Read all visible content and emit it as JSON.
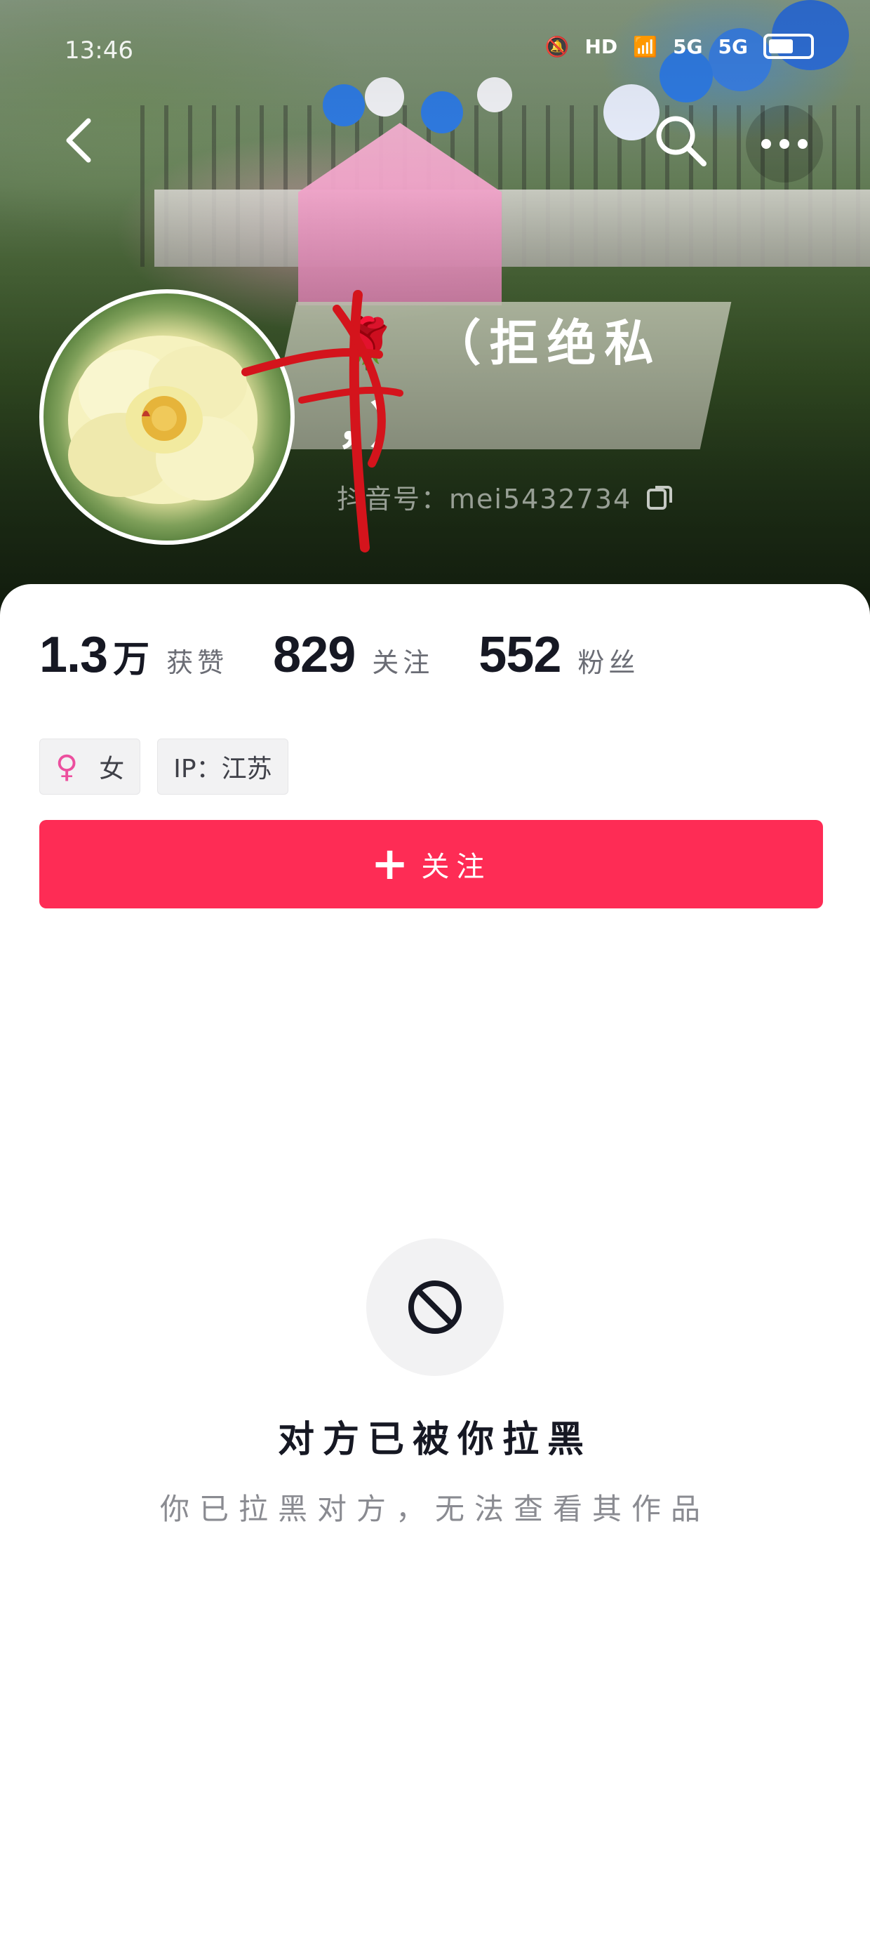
{
  "status_bar": {
    "time": "13:46",
    "hd_label": "HD",
    "signal1_label": "5G",
    "signal2_label": "5G",
    "battery_level": 0.6
  },
  "profile": {
    "nickname_line1": "🌹 （拒绝私",
    "nickname_line2": "，）",
    "douyin_id": "抖音号：mei5432734"
  },
  "stats": {
    "likes_num": "1.3",
    "likes_unit": "万",
    "likes_label": "获赞",
    "following_num": "829",
    "following_label": "关注",
    "followers_num": "552",
    "followers_label": "粉丝"
  },
  "tags": {
    "gender_icon": "♀",
    "gender_label": "女",
    "ip_label": "IP：江苏"
  },
  "follow_button": {
    "label": "关注",
    "color": "#fe2c55"
  },
  "blocked": {
    "title": "对方已被你拉黑",
    "subtitle": "你已拉黑对方，无法查看其作品"
  },
  "icons": {
    "back": "back-arrow-icon",
    "search": "search-icon",
    "more": "more-dots-icon",
    "copy": "copy-icon",
    "blocked": "block-icon"
  }
}
